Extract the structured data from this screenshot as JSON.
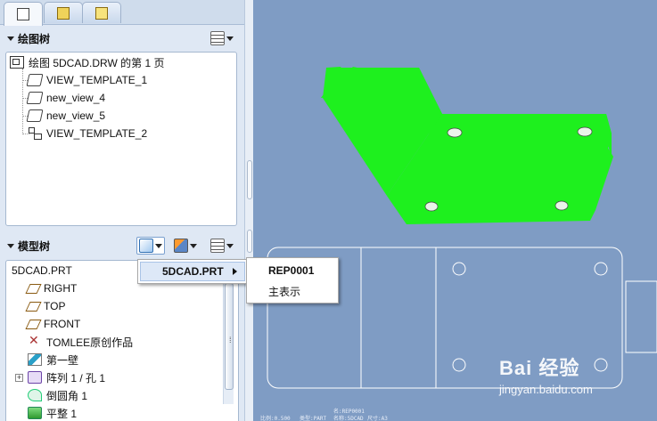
{
  "tabs": [
    {
      "icon": "model-tree-icon",
      "active": true
    },
    {
      "icon": "folder-browser-icon",
      "active": false
    },
    {
      "icon": "favorites-icon",
      "active": false
    }
  ],
  "drawing_tree": {
    "title": "绘图树",
    "root": "绘图 5DCAD.DRW 的第 1 页",
    "items": [
      "VIEW_TEMPLATE_1",
      "new_view_4",
      "new_view_5",
      "VIEW_TEMPLATE_2"
    ]
  },
  "model_tree": {
    "title": "模型树",
    "root": "5DCAD.PRT",
    "items": [
      "RIGHT",
      "TOP",
      "FRONT",
      "TOMLEE原创作品",
      "第一壁",
      "阵列 1 / 孔 1",
      "倒圆角 1",
      "平整 1"
    ]
  },
  "popup": {
    "model_item": "5DCAD.PRT",
    "submenu": [
      "REP0001",
      "主表示"
    ]
  },
  "status_bar": {
    "line1": "名:REP0001",
    "line2_a": "比例:0.500",
    "line2_b": "类型:PART",
    "line2_c": "名称:5DCAD",
    "line2_d": "尺寸:A3"
  },
  "watermark": {
    "logo": "Bai 经验",
    "sub": "jingyan.baidu.com"
  },
  "colors": {
    "canvas_bg": "#7f9cc4",
    "part_green": "#1ef01e",
    "line_white": "#ffffff"
  }
}
